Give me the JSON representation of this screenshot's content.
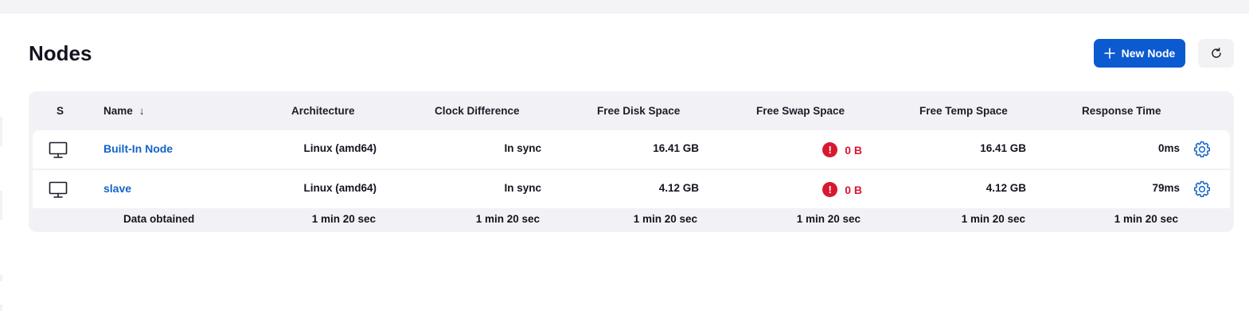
{
  "page": {
    "title": "Nodes",
    "new_node_label": "New Node"
  },
  "table": {
    "headers": {
      "status": "S",
      "name": "Name",
      "sort_indicator": "↓",
      "architecture": "Architecture",
      "clock": "Clock Difference",
      "disk": "Free Disk Space",
      "swap": "Free Swap Space",
      "temp": "Free Temp Space",
      "response": "Response Time"
    },
    "rows": [
      {
        "name": "Built-In Node",
        "architecture": "Linux (amd64)",
        "clock": "In sync",
        "disk": "16.41 GB",
        "swap": "0 B",
        "swap_warning": "!",
        "temp": "16.41 GB",
        "response": "0ms"
      },
      {
        "name": "slave",
        "architecture": "Linux (amd64)",
        "clock": "In sync",
        "disk": "4.12 GB",
        "swap": "0 B",
        "swap_warning": "!",
        "temp": "4.12 GB",
        "response": "79ms"
      }
    ],
    "footer": {
      "label": "Data obtained",
      "architecture": "1 min 20 sec",
      "clock": "1 min 20 sec",
      "disk": "1 min 20 sec",
      "swap": "1 min 20 sec",
      "temp": "1 min 20 sec",
      "response": "1 min 20 sec"
    }
  },
  "colors": {
    "accent": "#0b5ad0",
    "link": "#1464c8",
    "danger": "#d8182f",
    "table_bg": "#f2f2f6"
  },
  "icons": {
    "new_node": "plus-icon",
    "refresh": "refresh-icon",
    "node_status": "computer-icon",
    "configure": "gear-icon",
    "swap_warning": "error-circle-icon"
  }
}
